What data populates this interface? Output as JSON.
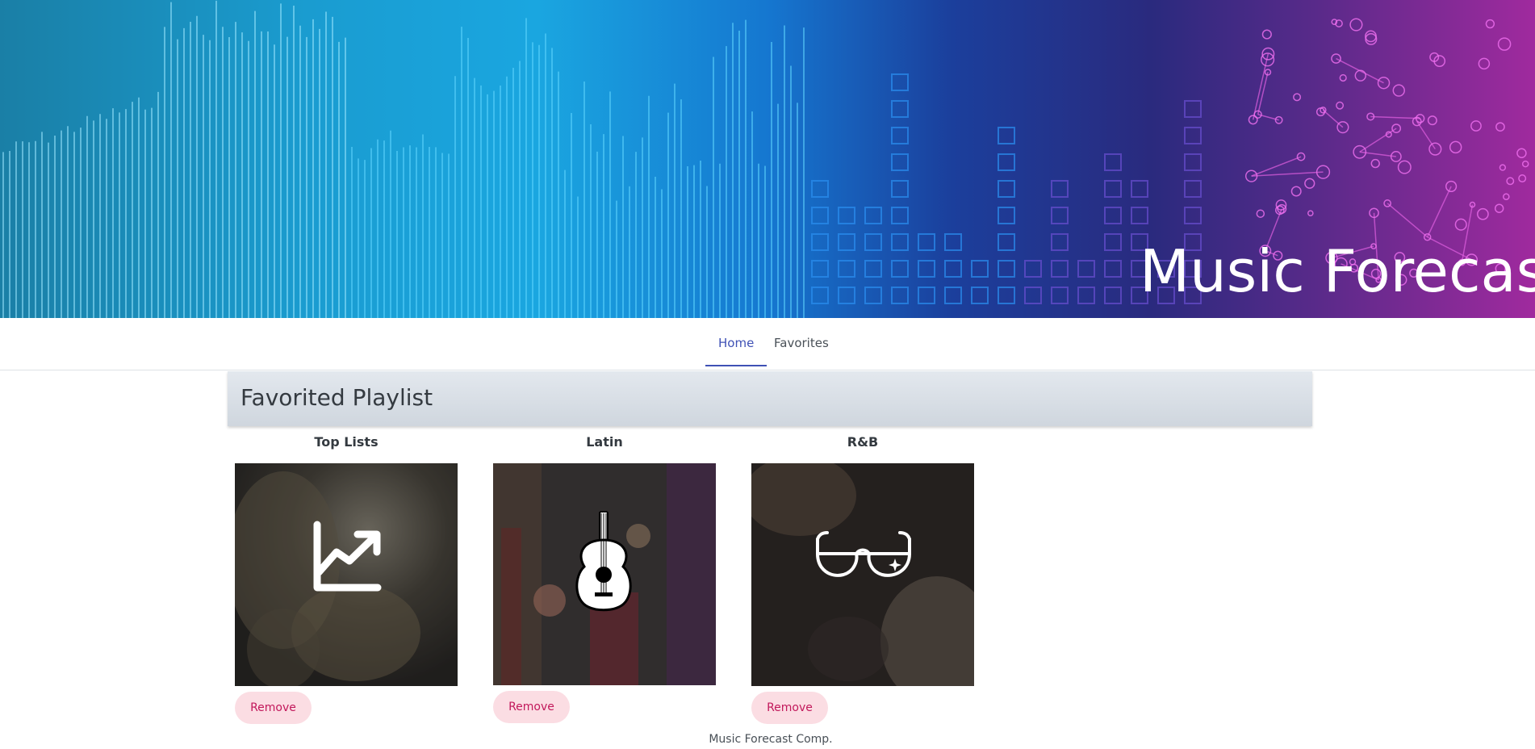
{
  "banner": {
    "title": "Music Forecast"
  },
  "nav": {
    "tabs": [
      {
        "label": "Home",
        "active": true
      },
      {
        "label": "Favorites",
        "active": false
      }
    ]
  },
  "main": {
    "section_title": "Favorited Playlist",
    "cards": [
      {
        "title": "Top Lists",
        "icon": "trending-up-icon",
        "remove_label": "Remove"
      },
      {
        "title": "Latin",
        "icon": "guitar-icon",
        "remove_label": "Remove"
      },
      {
        "title": "R&B",
        "icon": "sunglasses-icon",
        "remove_label": "Remove"
      }
    ]
  },
  "footer": {
    "text": "Music Forecast Comp."
  },
  "colors": {
    "accent": "#3f51b5",
    "remove_bg": "#fbdde3",
    "remove_text": "#c2185b"
  }
}
